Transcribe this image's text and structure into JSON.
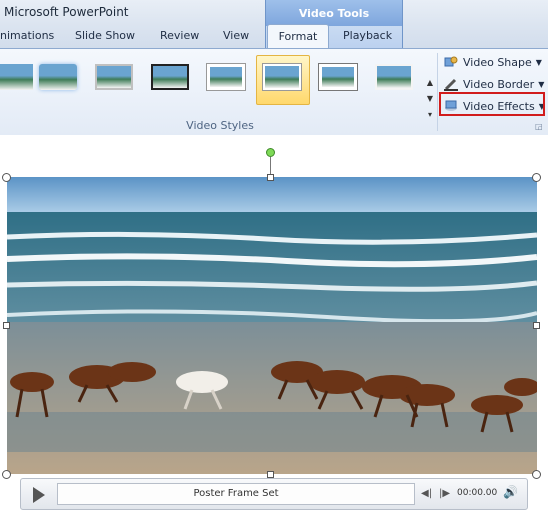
{
  "window": {
    "title": "Microsoft PowerPoint"
  },
  "ribbon": {
    "contextual_header": "Video Tools",
    "tabs": [
      "nimations",
      "Slide Show",
      "Review",
      "View",
      "Format",
      "Playback"
    ],
    "active_tab": "Format",
    "group_label": "Video Styles",
    "commands": {
      "video_shape": "Video Shape",
      "video_border": "Video Border",
      "video_effects": "Video Effects"
    },
    "gallery_count": 9,
    "selected_style_index": 5
  },
  "player": {
    "status": "Poster Frame Set",
    "time": "00:00.00"
  },
  "colors": {
    "highlight": "#d11c1c",
    "contextual_tab": "#7ea6dd",
    "selected_style": "#ffd86c"
  },
  "icons": {
    "play": "play-icon",
    "step_back": "step-back-icon",
    "step_forward": "step-forward-icon",
    "volume": "volume-icon"
  }
}
